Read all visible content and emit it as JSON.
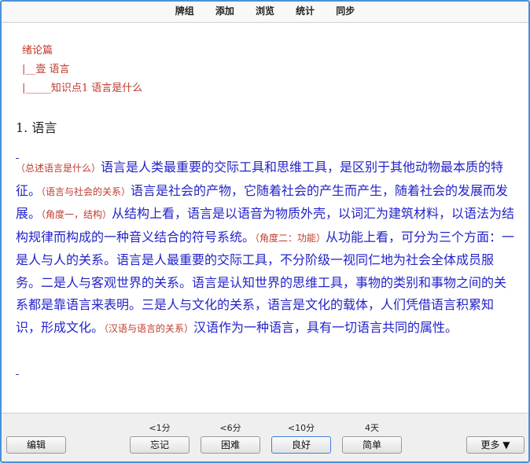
{
  "menu": [
    "牌组",
    "添加",
    "浏览",
    "统计",
    "同步"
  ],
  "breadcrumb": {
    "line1": "绪论篇",
    "line2": "|__壹 语言",
    "line3": "|_____知识点1 语言是什么"
  },
  "section_title": "1. 语言",
  "paragraph": [
    {
      "note": "（总述语言是什么）",
      "text": "语言是人类最重要的交际工具和思维工具，是区别于其他动物最本质的特征。"
    },
    {
      "note": "（语言与社会的关系）",
      "text": "语言是社会的产物，它随着社会的产生而产生，随着社会的发展而发展。"
    },
    {
      "note": "（角度一，结构）",
      "text": "从结构上看，语言是以语音为物质外壳，以词汇为建筑材料，以语法为结构规律而构成的一种音义结合的符号系统。"
    },
    {
      "note": "（角度二：功能）",
      "text": "从功能上看，可分为三个方面：一是人与人的关系。语言是人最重要的交际工具，不分阶级一视同仁地为社会全体成员服务。二是人与客观世界的关系。语言是认知世界的思维工具，事物的类别和事物之间的关系都是靠语言来表明。三是人与文化的关系，语言是文化的载体，人们凭借语言积累知识，形成文化。"
    },
    {
      "note": "（汉语与语言的关系）",
      "text": "汉语作为一种语言，具有一切语言共同的属性。"
    }
  ],
  "bottom": {
    "edit": "编辑",
    "more": "更多 ▼",
    "answers": [
      {
        "interval": "<1分",
        "label": "忘记"
      },
      {
        "interval": "<6分",
        "label": "困难"
      },
      {
        "interval": "<10分",
        "label": "良好"
      },
      {
        "interval": "4天",
        "label": "简单"
      }
    ]
  }
}
